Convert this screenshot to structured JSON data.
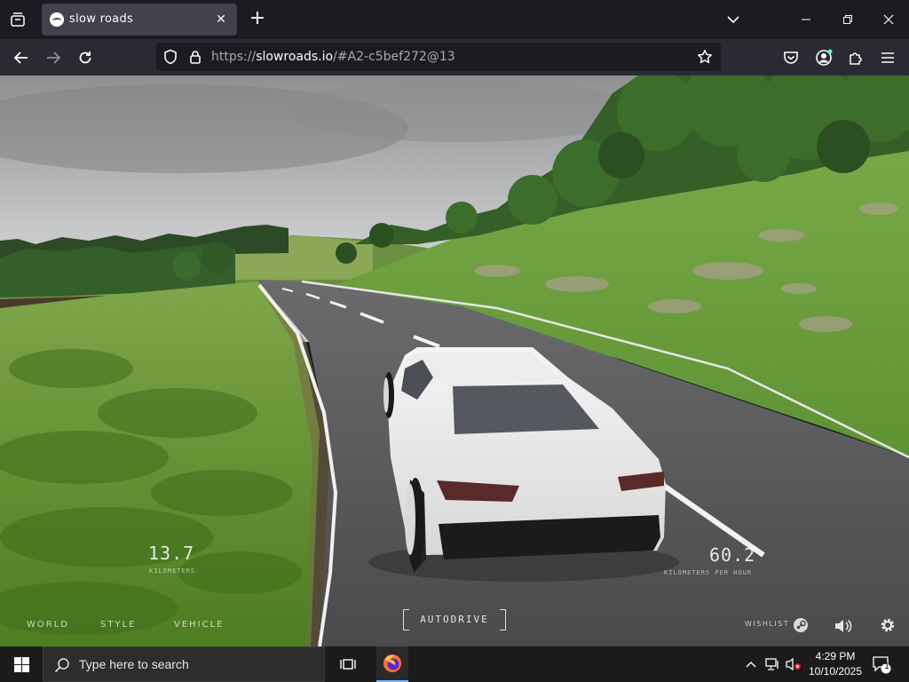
{
  "browser": {
    "tab": {
      "title": "slow roads"
    },
    "url": {
      "prefix": "https://",
      "host": "slowroads.io",
      "rest": "/#A2-c5bef272@13"
    }
  },
  "game": {
    "hud": {
      "distance": {
        "value": "13.7",
        "unit": "KILOMETERS"
      },
      "speed": {
        "value": "60.2",
        "unit": "KILOMETERS PER HOUR"
      }
    },
    "menu": [
      "WORLD",
      "STYLE",
      "VEHICLE"
    ],
    "autodrive_label": "AUTODRIVE",
    "wishlist_label": "WISHLIST",
    "icons": [
      "steam-icon",
      "volume-icon",
      "settings-gear-icon"
    ]
  },
  "taskbar": {
    "search_placeholder": "Type here to search",
    "clock": {
      "time": "4:29 PM",
      "date": "10/10/2025"
    },
    "notification_count": "1"
  }
}
